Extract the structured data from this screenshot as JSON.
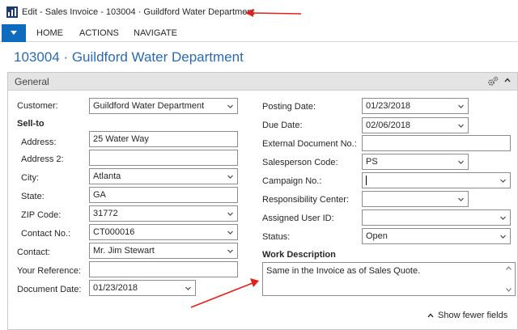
{
  "window": {
    "title": "Edit - Sales Invoice - 103004 · Guildford Water Department"
  },
  "ribbon": {
    "tabs": [
      "HOME",
      "ACTIONS",
      "NAVIGATE"
    ]
  },
  "page": {
    "title": "103004 · Guildford Water Department"
  },
  "panel": {
    "title": "General",
    "show_fewer_label": "Show fewer fields"
  },
  "left": {
    "customer": {
      "label": "Customer:",
      "value": "Guildford Water Department"
    },
    "sell_to_heading": "Sell-to",
    "address": {
      "label": "Address:",
      "value": "25 Water Way"
    },
    "address2": {
      "label": "Address 2:",
      "value": ""
    },
    "city": {
      "label": "City:",
      "value": "Atlanta"
    },
    "state": {
      "label": "State:",
      "value": "GA"
    },
    "zip": {
      "label": "ZIP Code:",
      "value": "31772"
    },
    "contact_no": {
      "label": "Contact No.:",
      "value": "CT000016"
    },
    "contact": {
      "label": "Contact:",
      "value": "Mr. Jim Stewart"
    },
    "your_reference": {
      "label": "Your Reference:",
      "value": ""
    },
    "document_date": {
      "label": "Document Date:",
      "value": "01/23/2018"
    }
  },
  "right": {
    "posting_date": {
      "label": "Posting Date:",
      "value": "01/23/2018"
    },
    "due_date": {
      "label": "Due Date:",
      "value": "02/06/2018"
    },
    "external_doc": {
      "label": "External Document No.:",
      "value": ""
    },
    "salesperson": {
      "label": "Salesperson Code:",
      "value": "PS"
    },
    "campaign": {
      "label": "Campaign No.:",
      "value": ""
    },
    "resp_center": {
      "label": "Responsibility Center:",
      "value": ""
    },
    "assigned_user": {
      "label": "Assigned User ID:",
      "value": ""
    },
    "status": {
      "label": "Status:",
      "value": "Open"
    },
    "work_description": {
      "label": "Work Description",
      "value": "Same in the Invoice as of Sales Quote."
    }
  },
  "colors": {
    "accent": "#0e6bbd",
    "title_blue": "#2d6aab",
    "annotation_arrow": "#e0221c"
  },
  "icons": {
    "app": "dynamics-nav-icon",
    "menu": "app-menu-triangle-icon",
    "gears": "gears-icon",
    "collapse": "chevron-up-icon",
    "dropdown": "chevron-down-icon"
  }
}
